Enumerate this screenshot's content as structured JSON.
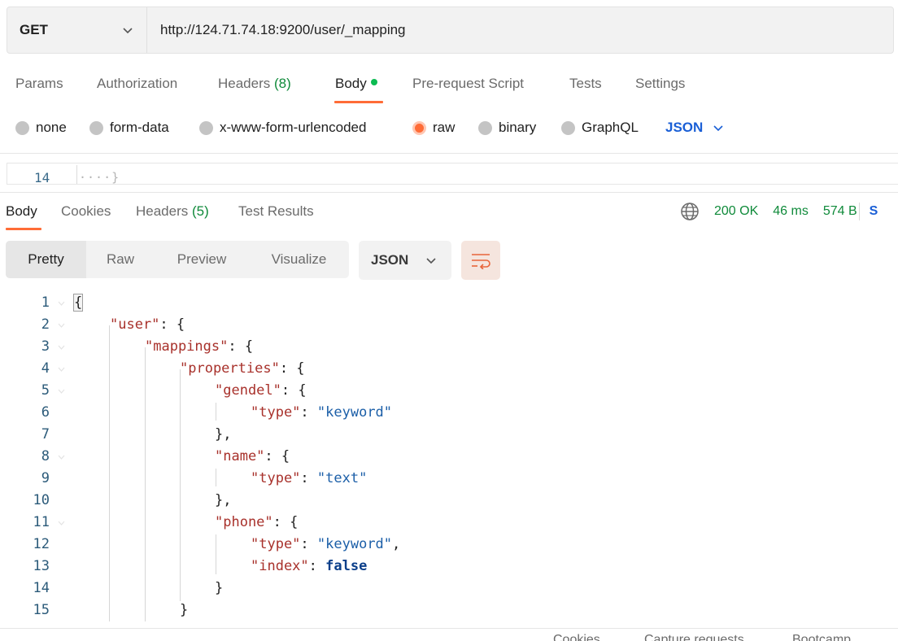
{
  "request": {
    "method": "GET",
    "url": "http://124.71.74.18:9200/user/_mapping"
  },
  "request_tabs": [
    {
      "label": "Params"
    },
    {
      "label": "Authorization"
    },
    {
      "label": "Headers",
      "count": "(8)"
    },
    {
      "label": "Body"
    },
    {
      "label": "Pre-request Script"
    },
    {
      "label": "Tests"
    },
    {
      "label": "Settings"
    }
  ],
  "body_types": [
    "none",
    "form-data",
    "x-www-form-urlencoded",
    "raw",
    "binary",
    "GraphQL"
  ],
  "body_format": "JSON",
  "request_editor": {
    "line": "14",
    "text": "····}"
  },
  "response_tabs": [
    {
      "label": "Body"
    },
    {
      "label": "Cookies"
    },
    {
      "label": "Headers",
      "count": "(5)"
    },
    {
      "label": "Test Results"
    }
  ],
  "response_status": {
    "status": "200 OK",
    "time": "46 ms",
    "size": "574 B",
    "save_peek": "S"
  },
  "view_modes": [
    "Pretty",
    "Raw",
    "Preview",
    "Visualize"
  ],
  "response_format": "JSON",
  "code_lines": [
    {
      "n": "1"
    },
    {
      "n": "2"
    },
    {
      "n": "3"
    },
    {
      "n": "4"
    },
    {
      "n": "5"
    },
    {
      "n": "6"
    },
    {
      "n": "7"
    },
    {
      "n": "8"
    },
    {
      "n": "9"
    },
    {
      "n": "10"
    },
    {
      "n": "11"
    },
    {
      "n": "12"
    },
    {
      "n": "13"
    },
    {
      "n": "14"
    },
    {
      "n": "15"
    }
  ],
  "json_tokens": {
    "open": "{",
    "user_key": "\"user\"",
    "mappings_key": "\"mappings\"",
    "properties_key": "\"properties\"",
    "gendel_key": "\"gendel\"",
    "type_key": "\"type\"",
    "keyword_val": "\"keyword\"",
    "name_key": "\"name\"",
    "text_val": "\"text\"",
    "phone_key": "\"phone\"",
    "index_key": "\"index\"",
    "false_val": "false",
    "colon_brace": ": {",
    "colon": ": ",
    "comma": ",",
    "close": "}",
    "close_comma": "},"
  },
  "footer": [
    "Cookies",
    "Capture requests",
    "Bootcamp"
  ],
  "colors": {
    "accent": "#ff6c37",
    "success": "#0f8a3a",
    "link": "#1a5fd6"
  }
}
